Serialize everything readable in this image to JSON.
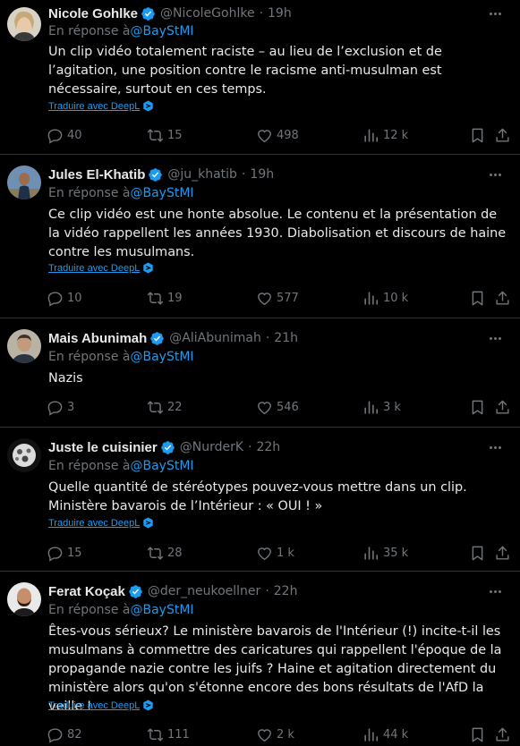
{
  "colors": {
    "background": "#000000",
    "text": "#e7e9ea",
    "muted": "#71767b",
    "accent": "#1d9bf0",
    "divider": "#2f3336"
  },
  "tweets": [
    {
      "name": "Nicole Gohlke",
      "handle": "@NicoleGohlke",
      "time": "19h",
      "reply_prefix": "En réponse à",
      "reply_to": "@BayStMI",
      "text": "Un clip vidéo totalement raciste – au lieu de l’exclusion et de l’agitation, une position contre le racisme anti-musulman est nécessaire, surtout en ces temps.",
      "translate": "Traduire avec DeepL",
      "replies": "40",
      "retweets": "15",
      "likes": "498",
      "views": "12 k"
    },
    {
      "name": "Jules El-Khatib",
      "handle": "@ju_khatib",
      "time": "19h",
      "reply_prefix": "En réponse à",
      "reply_to": "@BayStMI",
      "text": "Ce clip vidéo est une honte absolue. Le contenu et la présentation de la vidéo rappellent les années 1930. Diabolisation et discours de haine contre les musulmans.",
      "translate": "Traduire avec DeepL",
      "replies": "10",
      "retweets": "19",
      "likes": "577",
      "views": "10 k"
    },
    {
      "name": "Mais Abunimah",
      "handle": "@AliAbunimah",
      "time": "21h",
      "reply_prefix": "En réponse à",
      "reply_to": "@BayStMI",
      "text": "Nazis",
      "translate": "",
      "replies": "3",
      "retweets": "22",
      "likes": "546",
      "views": "3 k"
    },
    {
      "name": "Juste le cuisinier",
      "handle": "@NurderK",
      "time": "22h",
      "reply_prefix": "En réponse à",
      "reply_to": "@BayStMI",
      "text": "Quelle quantité de stéréotypes pouvez-vous mettre dans un clip. Ministère bavarois de l’Intérieur : « OUI ! »",
      "translate": "Traduire avec DeepL",
      "replies": "15",
      "retweets": "28",
      "likes": "1 k",
      "views": "35 k"
    },
    {
      "name": "Ferat Koçak",
      "handle": "@der_neukoellner",
      "time": "22h",
      "reply_prefix": "En réponse à",
      "reply_to": "@BayStMI",
      "text": "Êtes-vous sérieux? Le ministère bavarois de l'Intérieur (!) incite-t-il les musulmans à commettre des caricatures qui rappellent l'époque de la propagande nazie contre les juifs ? Haine et agitation directement du ministère alors qu'on s'étonne encore des bons résultats de l'AfD la veille !",
      "translate": "Traduire avec DeepL",
      "replies": "82",
      "retweets": "111",
      "likes": "2 k",
      "views": "44 k"
    }
  ]
}
